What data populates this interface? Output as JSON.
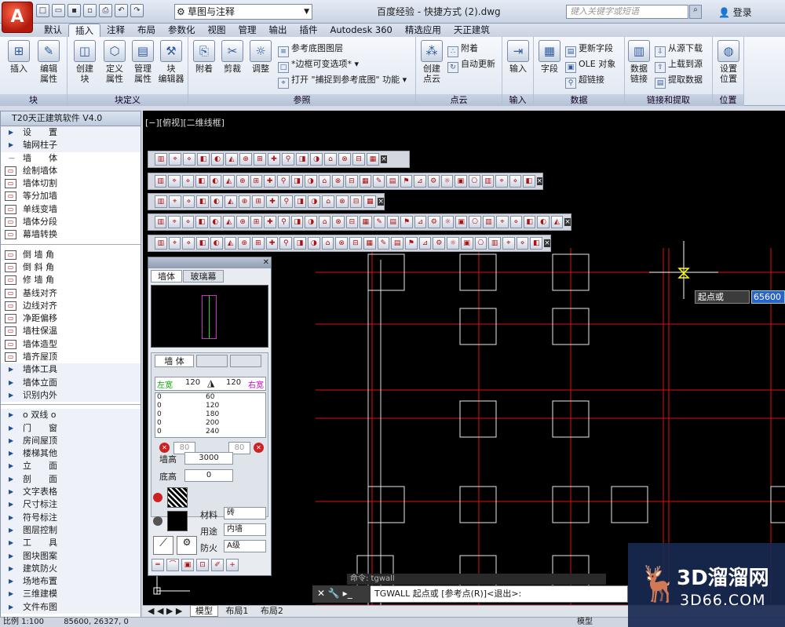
{
  "app": {
    "logo_letter": "A",
    "workspace": "草图与注释",
    "doc_title": "百度经验 - 快捷方式 (2).dwg",
    "search_placeholder": "键入关键字或短语",
    "login": "登录"
  },
  "tabs": [
    "默认",
    "插入",
    "注释",
    "布局",
    "参数化",
    "视图",
    "管理",
    "输出",
    "插件",
    "Autodesk 360",
    "精选应用",
    "天正建筑"
  ],
  "active_tab": "插入",
  "ribbon": {
    "block_panel": {
      "title": "块",
      "buttons": [
        "插入",
        "编辑\n属性"
      ]
    },
    "blockdef_panel": {
      "title": "块定义",
      "buttons": [
        "创建\n块",
        "定义\n属性",
        "管理\n属性",
        "块\n编辑器"
      ]
    },
    "ref_panel": {
      "title": "参照",
      "buttons": [
        "附着",
        "剪裁",
        "调整"
      ],
      "small": [
        "参考底图图层",
        "*边框可变选项*",
        "打开 \"捕捉到参考底图\" 功能"
      ]
    },
    "cloud_panel": {
      "title": "点云",
      "buttons": [
        "创建\n点云"
      ],
      "small": [
        "附着",
        "自动更新"
      ]
    },
    "import_panel": {
      "title": "输入",
      "buttons": [
        "输入"
      ]
    },
    "data_panel": {
      "title": "数据",
      "buttons": [
        "字段"
      ],
      "small": [
        "更新字段",
        "OLE 对象",
        "超链接"
      ]
    },
    "link_panel": {
      "title": "链接和提取",
      "buttons": [
        "数据\n链接"
      ],
      "small": [
        "从源下载",
        "上载到源",
        "提取数据"
      ]
    },
    "pos_panel": {
      "title": "位置",
      "buttons": [
        "设置\n位置"
      ]
    }
  },
  "sidebar": {
    "title": "T20天正建筑软件 V4.0",
    "items": [
      {
        "label": "设　　置",
        "type": "head"
      },
      {
        "label": "轴网柱子",
        "type": "head"
      },
      {
        "label": "墙　　体",
        "type": "open"
      },
      {
        "label": "绘制墙体",
        "type": "tool"
      },
      {
        "label": "墙体切割",
        "type": "tool"
      },
      {
        "label": "等分加墙",
        "type": "tool"
      },
      {
        "label": "单线变墙",
        "type": "tool"
      },
      {
        "label": "墙体分段",
        "type": "tool"
      },
      {
        "label": "幕墙转换",
        "type": "tool"
      },
      {
        "label": "",
        "type": "sep"
      },
      {
        "label": "倒 墙 角",
        "type": "tool"
      },
      {
        "label": "倒 斜 角",
        "type": "tool"
      },
      {
        "label": "修 墙 角",
        "type": "tool"
      },
      {
        "label": "基线对齐",
        "type": "tool"
      },
      {
        "label": "边线对齐",
        "type": "tool"
      },
      {
        "label": "净距偏移",
        "type": "tool"
      },
      {
        "label": "墙柱保温",
        "type": "tool"
      },
      {
        "label": "墙体造型",
        "type": "tool"
      },
      {
        "label": "墙齐屋顶",
        "type": "tool"
      },
      {
        "label": "墙体工具",
        "type": "head"
      },
      {
        "label": "墙体立面",
        "type": "head"
      },
      {
        "label": "识别内外",
        "type": "head"
      },
      {
        "label": "",
        "type": "sep"
      },
      {
        "label": "o 双线 o",
        "type": "head"
      },
      {
        "label": "门　　窗",
        "type": "head"
      },
      {
        "label": "房间屋顶",
        "type": "head"
      },
      {
        "label": "楼梯其他",
        "type": "head"
      },
      {
        "label": "立　　面",
        "type": "head"
      },
      {
        "label": "剖　　面",
        "type": "head"
      },
      {
        "label": "文字表格",
        "type": "head"
      },
      {
        "label": "尺寸标注",
        "type": "head"
      },
      {
        "label": "符号标注",
        "type": "head"
      },
      {
        "label": "图层控制",
        "type": "head"
      },
      {
        "label": "工　　具",
        "type": "head"
      },
      {
        "label": "图块图案",
        "type": "head"
      },
      {
        "label": "建筑防火",
        "type": "head"
      },
      {
        "label": "场地布置",
        "type": "head"
      },
      {
        "label": "三维建模",
        "type": "head"
      },
      {
        "label": "文件布图",
        "type": "head"
      }
    ]
  },
  "canvas": {
    "view_label": "[−][俯视][二维线框]",
    "tooltip_label": "起点或",
    "tooltip_value": "65600",
    "cmd_history": "命令: tgwall",
    "cmd_line": "TGWALL 起点或 [参考点(R)]<退出>:"
  },
  "wall_panel": {
    "tabs": [
      "墙体",
      "玻璃幕"
    ],
    "inner_tab": "墙 体",
    "left_label": "左宽",
    "right_label": "右宽",
    "left_width": "120",
    "right_width": "120",
    "list_left": [
      "0",
      "0",
      "0",
      "0",
      "0"
    ],
    "list_right": [
      "60",
      "120",
      "180",
      "200",
      "240"
    ],
    "small_left": "80",
    "small_right": "80",
    "height_label": "墙高",
    "height_value": "3000",
    "base_label": "底高",
    "base_value": "0",
    "material_label": "材料",
    "material_value": "砖",
    "usage_label": "用途",
    "usage_value": "内墙",
    "fire_label": "防火",
    "fire_value": "A级"
  },
  "layout_tabs": [
    "模型",
    "布局1",
    "布局2"
  ],
  "status": {
    "scale": "比例 1:100",
    "coords": "85600, 26327, 0",
    "model": "模型"
  },
  "watermark": {
    "brand": "3D溜溜网",
    "site": "3D66.COM"
  }
}
